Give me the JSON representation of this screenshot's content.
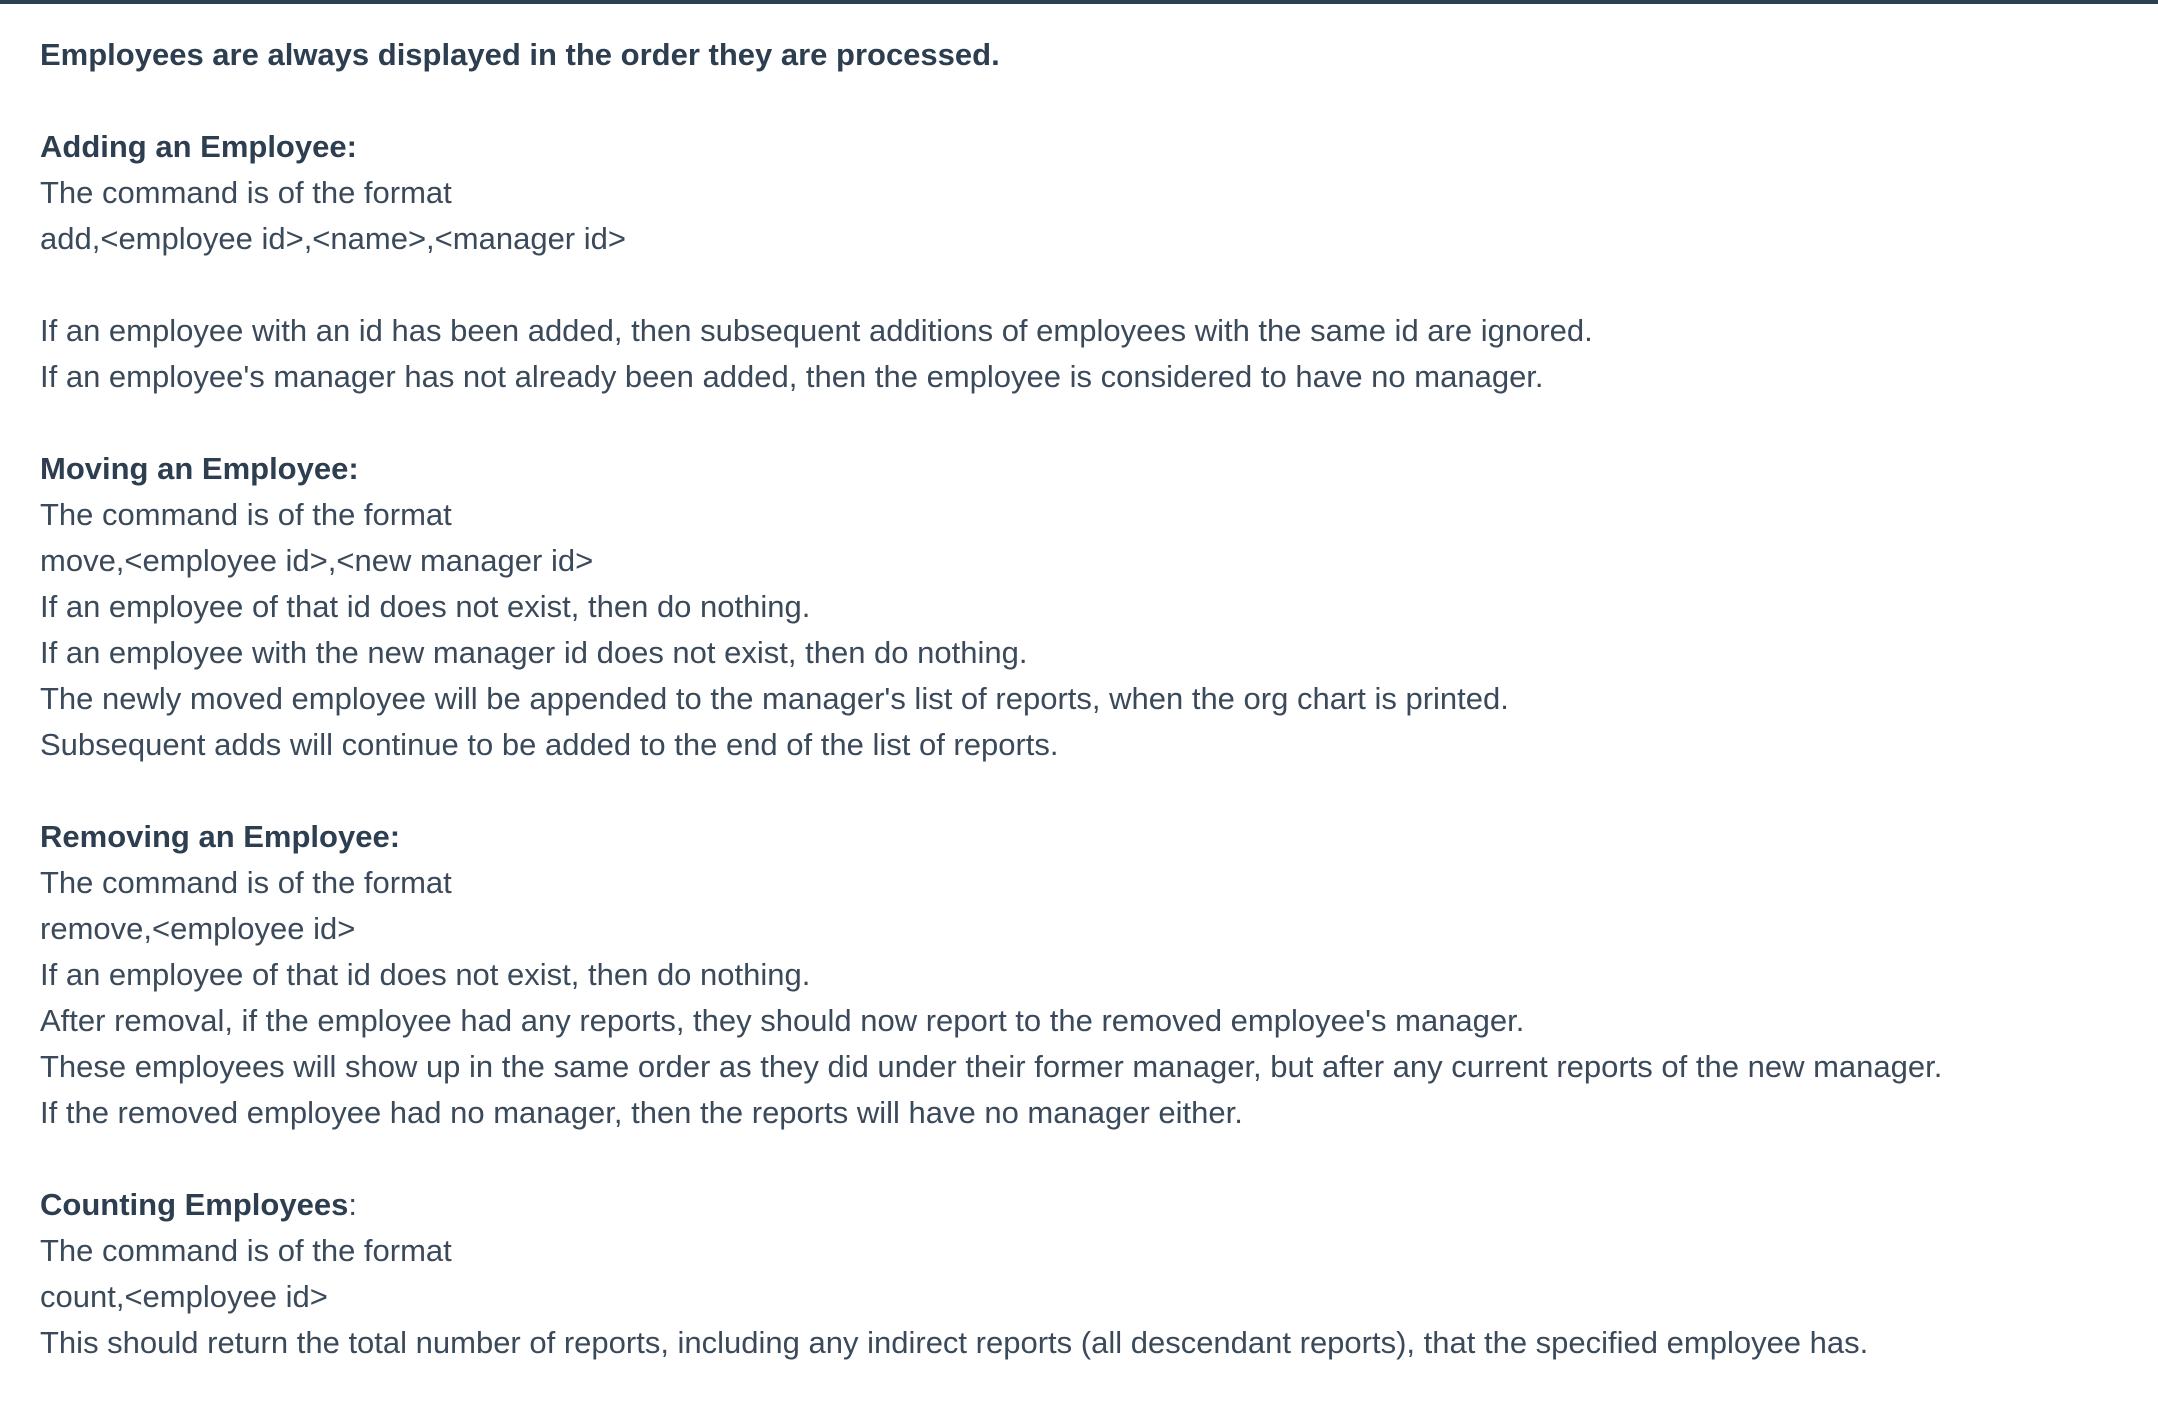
{
  "intro": "Employees are always displayed in the order they are processed.",
  "sections": [
    {
      "heading": "Adding an Employee:",
      "lines": [
        "The command is of the format",
        "add,<employee id>,<name>,<manager id>"
      ],
      "extra": [
        "If an employee with an id has been added, then subsequent additions of employees with the same id are ignored.",
        "If an employee's manager has not already been added, then the employee is considered to have no manager."
      ]
    },
    {
      "heading": "Moving an Employee:",
      "lines": [
        "The command is of the format",
        "move,<employee id>,<new manager id>",
        "If an employee of that id does not exist, then do nothing.",
        "If an employee with the new manager id does not exist, then do nothing.",
        "The newly moved employee will be appended to the manager's list of reports, when the org chart is printed.",
        "Subsequent adds will continue to be added to the end of the list of reports."
      ]
    },
    {
      "heading": "Removing an Employee:",
      "lines": [
        "The command is of the format",
        "remove,<employee id>",
        "If an employee of that id does not exist, then do nothing.",
        "After removal, if the employee had any reports, they should now report to the removed employee's manager.",
        "These employees will show up in the same order as they did under their former manager, but after any current reports of the new manager.",
        "If the removed employee had no manager, then the reports will have no manager either."
      ]
    },
    {
      "heading": "Counting Employees",
      "heading_suffix": ":",
      "lines": [
        "The command is of the format",
        "count,<employee id>",
        "This should return the total number of reports, including any indirect reports (all descendant reports), that the specified employee has."
      ]
    }
  ]
}
